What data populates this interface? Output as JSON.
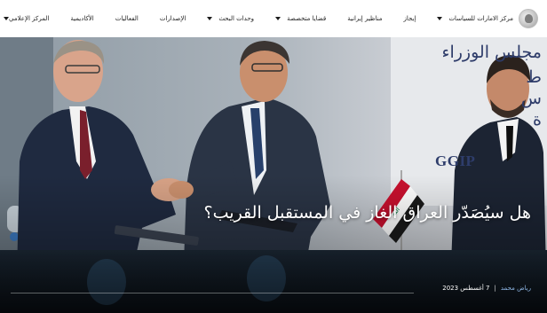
{
  "brand": {
    "name": "مركز الامارات للسياسات"
  },
  "nav": {
    "items": [
      {
        "label": "مركز الامارات للسياسات",
        "dropdown": true
      },
      {
        "label": "إيجاز",
        "dropdown": false
      },
      {
        "label": "مناظير إيرانية",
        "dropdown": false
      },
      {
        "label": "قضايا متخصصة",
        "dropdown": true
      },
      {
        "label": "وحدات البحث",
        "dropdown": true
      },
      {
        "label": "الإصدارات",
        "dropdown": false
      },
      {
        "label": "الفعاليات",
        "dropdown": false
      },
      {
        "label": "الأكاديمية",
        "dropdown": false
      },
      {
        "label": "المركز الإعلامي",
        "dropdown": false
      }
    ]
  },
  "hero": {
    "backdrop_line": "مجلس الوزراء",
    "backdrop_letter_2": "ط",
    "backdrop_letter_3": "س",
    "backdrop_letter_4": "ة",
    "backdrop_logo": "GGIP",
    "headline": "هل سيُصَدّر العراق الغاز في المستقبل القريب؟",
    "author": "رياض محمد",
    "separator": "|",
    "date": "7 أغسطس 2023"
  },
  "colors": {
    "nav_text": "#1c1c1c",
    "headline": "#ffffff",
    "author_link": "#8fb7e6",
    "backdrop_text": "#2d3b69",
    "iraq_flag_red": "#c8102e",
    "iraq_flag_green": "#007a3d"
  },
  "icons": {
    "logo": "emirates-policy-center-logo",
    "dropdown": "caret-down-icon"
  }
}
